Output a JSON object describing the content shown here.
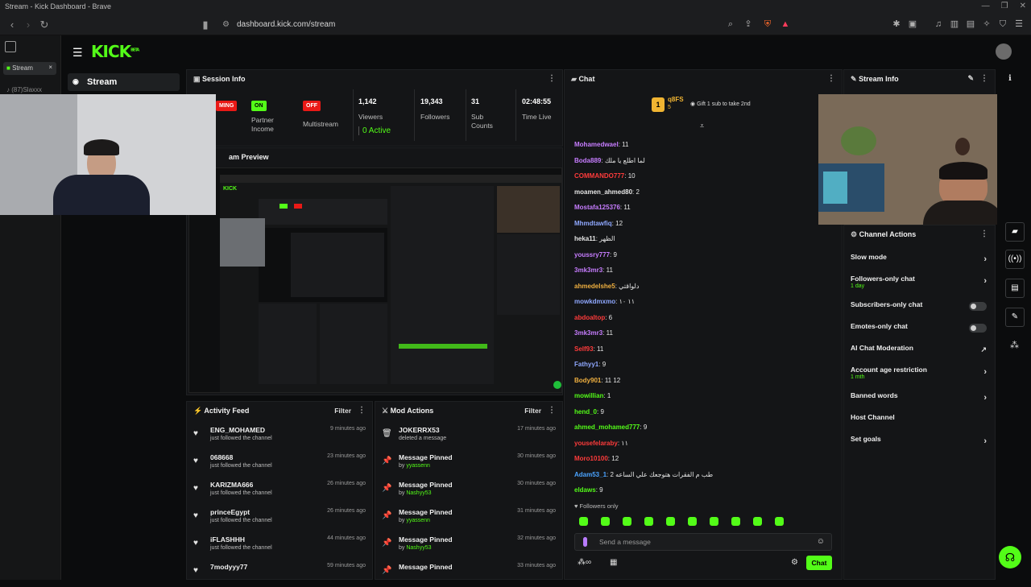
{
  "browser": {
    "window_title": "Stream - Kick Dashboard - Brave",
    "url": "dashboard.kick.com/stream",
    "tabs": [
      {
        "label": "Stream",
        "close": "×"
      },
      {
        "label": "(87)Slaxxx"
      }
    ]
  },
  "app": {
    "logo": "KICK",
    "logo_tag": "BETA",
    "nav": {
      "stream_label": "Stream"
    }
  },
  "session": {
    "title": "Session Info",
    "live_badge": "MING",
    "partner_badge": "ON",
    "partner_label": "Partner Income",
    "multistream_badge": "OFF",
    "multistream_label": "Multistream",
    "viewers_value": "1,142",
    "viewers_label": "Viewers",
    "active_value": "0 Active",
    "followers_value": "19,343",
    "followers_label": "Followers",
    "subs_value": "31",
    "subs_label": "Sub Counts",
    "time_value": "02:48:55",
    "time_label": "Time Live",
    "cut_label": "n"
  },
  "preview": {
    "title": "am Preview"
  },
  "activity": {
    "title": "Activity Feed",
    "filter": "Filter",
    "items": [
      {
        "name": "ENG_MOHAMED",
        "sub": "just followed the channel",
        "time": "9 minutes ago"
      },
      {
        "name": "068668",
        "sub": "just followed the channel",
        "time": "23 minutes ago"
      },
      {
        "name": "KARIZMA666",
        "sub": "just followed the channel",
        "time": "26 minutes ago"
      },
      {
        "name": "princeEgypt",
        "sub": "just followed the channel",
        "time": "26 minutes ago"
      },
      {
        "name": "iFLASHHH",
        "sub": "just followed the channel",
        "time": "44 minutes ago"
      },
      {
        "name": "7modyyy77",
        "sub": "",
        "time": "59 minutes ago"
      }
    ]
  },
  "mod": {
    "title": "Mod Actions",
    "filter": "Filter",
    "items": [
      {
        "name": "JOKERRX53",
        "sub": "deleted a message",
        "by": "",
        "time": "17 minutes ago"
      },
      {
        "name": "Message Pinned",
        "sub": "by",
        "by": "yyassenn",
        "time": "30 minutes ago"
      },
      {
        "name": "Message Pinned",
        "sub": "by",
        "by": "Nashyy53",
        "time": "30 minutes ago"
      },
      {
        "name": "Message Pinned",
        "sub": "by",
        "by": "yyassenn",
        "time": "31 minutes ago"
      },
      {
        "name": "Message Pinned",
        "sub": "by",
        "by": "Nashyy53",
        "time": "32 minutes ago"
      },
      {
        "name": "Message Pinned",
        "sub": "",
        "by": "",
        "time": "33 minutes ago"
      }
    ]
  },
  "chat": {
    "title": "Chat",
    "gifter_name": "q8FS",
    "gifter_rank": "1",
    "gifter_count": "5",
    "gift_prompt": "Gift 1 sub to take 2nd",
    "followers_only": "Followers only",
    "placeholder": "Send a message",
    "send_label": "Chat",
    "messages": [
      {
        "user": "Mohamedwael",
        "text": "11",
        "color": "#c77dff"
      },
      {
        "user": "Boda889",
        "text": "لما اطلع يا ملك",
        "color": "#c77dff"
      },
      {
        "user": "COMMANDO777",
        "text": "10",
        "color": "#ff3b3b"
      },
      {
        "user": "moamen_ahmed80",
        "text": "2",
        "color": "#e6e6e6"
      },
      {
        "user": "Mostafa125376",
        "text": "11",
        "color": "#c77dff"
      },
      {
        "user": "Mhmdtawfiq",
        "text": "12",
        "color": "#8fa8ff"
      },
      {
        "user": "heka11",
        "text": "الظهر",
        "color": "#e6e6e6"
      },
      {
        "user": "youssry777",
        "text": "9",
        "color": "#c77dff"
      },
      {
        "user": "3mk3mr3",
        "text": "11",
        "color": "#c77dff"
      },
      {
        "user": "ahmedelshe5",
        "text": "دلواقتي",
        "color": "#f0b040"
      },
      {
        "user": "mowkdmxmo",
        "text": "١١ ١٠",
        "color": "#8fa8ff"
      },
      {
        "user": "abdoaltop",
        "text": "6",
        "color": "#ff3b3b"
      },
      {
        "user": "3mk3mr3",
        "text": "11",
        "color": "#c77dff"
      },
      {
        "user": "Self93",
        "text": "11",
        "color": "#ff3b3b"
      },
      {
        "user": "Fathyy1",
        "text": "9",
        "color": "#8fa8ff"
      },
      {
        "user": "Body901",
        "text": "11 12",
        "color": "#f0b040"
      },
      {
        "user": "mowillian",
        "text": "1",
        "color": "#53fc18"
      },
      {
        "user": "hend_0",
        "text": "9",
        "color": "#53fc18"
      },
      {
        "user": "ahmed_mohamed777",
        "text": "9",
        "color": "#53fc18"
      },
      {
        "user": "yousefelaraby",
        "text": "١١",
        "color": "#ff3b3b"
      },
      {
        "user": "Moro10100",
        "text": "12",
        "color": "#ff3b3b"
      },
      {
        "user": "Adam53_1",
        "text": "طب م الفقرات هتوجعك علي الساعه 2",
        "color": "#4aa3ff"
      },
      {
        "user": "eldaws",
        "text": "9",
        "color": "#53fc18"
      }
    ]
  },
  "stream_info": {
    "title": "Stream Info"
  },
  "channel_actions": {
    "title": "Channel Actions",
    "items": [
      {
        "label": "Slow mode",
        "sub": "",
        "kind": "chevron"
      },
      {
        "label": "Followers-only chat",
        "sub": "1 day",
        "kind": "chevron"
      },
      {
        "label": "Subscribers-only chat",
        "sub": "",
        "kind": "toggle"
      },
      {
        "label": "Emotes-only chat",
        "sub": "",
        "kind": "toggle"
      },
      {
        "label": "AI Chat Moderation",
        "sub": "",
        "kind": "external"
      },
      {
        "label": "Account age restriction",
        "sub": "1 mth",
        "kind": "chevron"
      },
      {
        "label": "Banned words",
        "sub": "",
        "kind": "chevron"
      },
      {
        "label": "Host Channel",
        "sub": "",
        "kind": "none"
      },
      {
        "label": "Set goals",
        "sub": "",
        "kind": "chevron"
      }
    ]
  },
  "colors": {
    "accent": "#53fc18",
    "live": "#e91916",
    "panel": "#141517"
  }
}
